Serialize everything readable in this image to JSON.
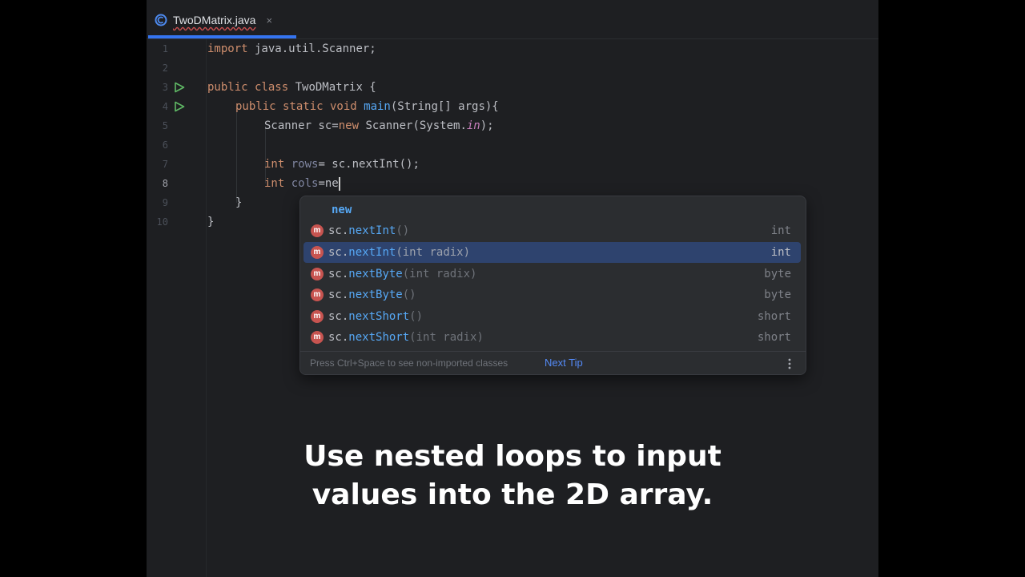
{
  "tab": {
    "label": "TwoDMatrix.java",
    "close": "×"
  },
  "lines": [
    {
      "num": "1"
    },
    {
      "num": "2"
    },
    {
      "num": "3"
    },
    {
      "num": "4"
    },
    {
      "num": "5"
    },
    {
      "num": "6"
    },
    {
      "num": "7"
    },
    {
      "num": "8"
    },
    {
      "num": "9"
    },
    {
      "num": "10"
    }
  ],
  "code": {
    "l1_kw": "import",
    "l1_rest": " java.util.Scanner;",
    "l3_kw": "public class",
    "l3_name": " TwoDMatrix",
    "l3_brace": " {",
    "l4_kw": "public static void",
    "l4_fn": " main",
    "l4_rest": "(String[] args){",
    "l5_a": "Scanner sc=",
    "l5_kw": "new",
    "l5_b": " Scanner(System.",
    "l5_in": "in",
    "l5_c": ");",
    "l7_kw": "int",
    "l7_var": " rows",
    "l7_rest": "= sc.nextInt();",
    "l8_kw": "int",
    "l8_var": " cols",
    "l8_rest": "=ne",
    "l9": "}",
    "l10": "}"
  },
  "completion": {
    "first": "new",
    "items": [
      {
        "prefix": "sc.",
        "name": "nextInt",
        "params": "()",
        "type": "int",
        "selected": false
      },
      {
        "prefix": "sc.",
        "name": "nextInt",
        "params": "(int radix)",
        "type": "int",
        "selected": true
      },
      {
        "prefix": "sc.",
        "name": "nextByte",
        "params": "(int radix)",
        "type": "byte",
        "selected": false
      },
      {
        "prefix": "sc.",
        "name": "nextByte",
        "params": "()",
        "type": "byte",
        "selected": false
      },
      {
        "prefix": "sc.",
        "name": "nextShort",
        "params": "()",
        "type": "short",
        "selected": false
      },
      {
        "prefix": "sc.",
        "name": "nextShort",
        "params": "(int radix)",
        "type": "short",
        "selected": false
      }
    ],
    "method_badge": "m",
    "hint": "Press Ctrl+Space to see non-imported classes",
    "next_tip": "Next Tip"
  },
  "caption": {
    "line1": "Use nested loops to input",
    "line2": "values into the 2D array."
  }
}
